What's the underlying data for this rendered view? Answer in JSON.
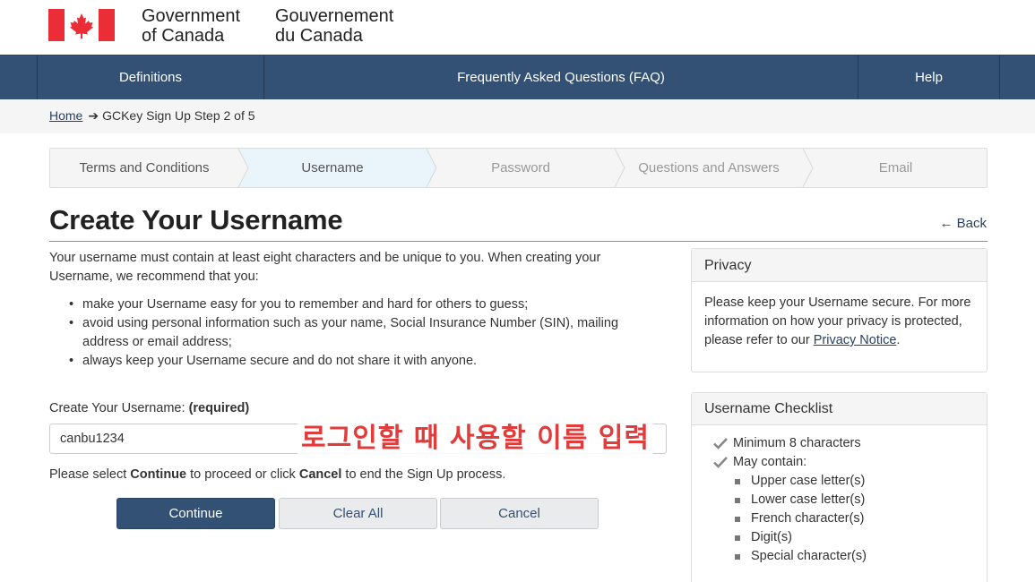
{
  "header": {
    "gov_en_line1": "Government",
    "gov_en_line2": "of Canada",
    "gov_fr_line1": "Gouvernement",
    "gov_fr_line2": "du Canada",
    "flag_color": "#eb2d37"
  },
  "nav": {
    "items": [
      {
        "label": "Definitions"
      },
      {
        "label": "Frequently Asked Questions (FAQ)"
      },
      {
        "label": "Help"
      }
    ],
    "bg_color": "#335075"
  },
  "breadcrumb": {
    "home": "Home",
    "arrow": "➔",
    "current": "GCKey Sign Up Step 2 of 5"
  },
  "steps": [
    {
      "label": "Terms and Conditions",
      "state": "done"
    },
    {
      "label": "Username",
      "state": "active"
    },
    {
      "label": "Password",
      "state": "pending"
    },
    {
      "label": "Questions and Answers",
      "state": "pending"
    },
    {
      "label": "Email",
      "state": "pending"
    }
  ],
  "page": {
    "title": "Create Your Username",
    "back": "← Back",
    "intro": "Your username must contain at least eight characters and be unique to you. When creating your Username, we recommend that you:",
    "bullets": [
      "make your Username easy for you to remember and hard for others to guess;",
      "avoid using personal information such as your name, Social Insurance Number (SIN), mailing address or email address;",
      "always keep your Username secure and do not share it with anyone."
    ]
  },
  "form": {
    "label": "Create Your Username:",
    "required": "(required)",
    "value": "canbu1234",
    "annotation": "로그인할 때 사용할 이름 입력",
    "proceed_prefix": "Please select ",
    "proceed_continue": "Continue",
    "proceed_middle": " to proceed or click ",
    "proceed_cancel": "Cancel",
    "proceed_suffix": " to end the Sign Up process."
  },
  "buttons": {
    "continue": "Continue",
    "clear_all": "Clear All",
    "cancel": "Cancel"
  },
  "privacy": {
    "title": "Privacy",
    "text": "Please keep your Username secure. For more information on how your privacy is protected, please refer to our ",
    "link": "Privacy Notice",
    "after": "."
  },
  "checklist": {
    "title": "Username Checklist",
    "items": [
      "Minimum 8 characters",
      "May contain:"
    ],
    "sub_items": [
      "Upper case letter(s)",
      "Lower case letter(s)",
      "French character(s)",
      "Digit(s)",
      "Special character(s)"
    ]
  }
}
